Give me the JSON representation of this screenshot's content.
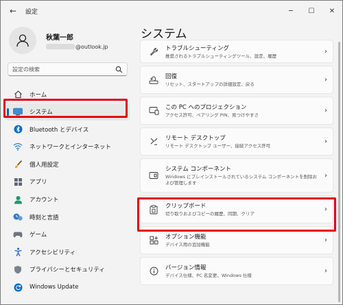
{
  "window": {
    "title": "設定",
    "back_glyph": "←",
    "minimize_glyph": "─",
    "maximize_glyph": "☐",
    "close_glyph": "✕"
  },
  "profile": {
    "name": "秋葉一郎",
    "email": "@outlook.jp"
  },
  "search": {
    "placeholder": "設定の検索"
  },
  "nav": {
    "items": [
      {
        "label": "ホーム",
        "icon": "home-icon"
      },
      {
        "label": "システム",
        "icon": "system-icon",
        "active": true
      },
      {
        "label": "Bluetooth とデバイス",
        "icon": "bluetooth-icon"
      },
      {
        "label": "ネットワークとインターネット",
        "icon": "network-icon"
      },
      {
        "label": "個人用設定",
        "icon": "brush-icon"
      },
      {
        "label": "アプリ",
        "icon": "apps-icon"
      },
      {
        "label": "アカウント",
        "icon": "account-icon"
      },
      {
        "label": "時刻と言語",
        "icon": "time-language-icon"
      },
      {
        "label": "ゲーム",
        "icon": "gaming-icon"
      },
      {
        "label": "アクセシビリティ",
        "icon": "accessibility-icon"
      },
      {
        "label": "プライバシーとセキュリティ",
        "icon": "shield-icon"
      },
      {
        "label": "Windows Update",
        "icon": "update-icon"
      }
    ]
  },
  "main": {
    "title": "システム",
    "cards": [
      {
        "title": "トラブルシューティング",
        "desc": "推奨されるトラブルシューティングツール、設定、履歴",
        "icon": "wrench-icon"
      },
      {
        "title": "回復",
        "desc": "リセット、スタートアップの詳細設定、戻る",
        "icon": "recovery-icon"
      },
      {
        "title": "この PC へのプロジェクション",
        "desc": "アクセス許可、ペアリング PIN、見つけやすさ",
        "icon": "projection-icon"
      },
      {
        "title": "リモート デスクトップ",
        "desc": "リモート デスクトップ ユーザー、接続アクセス許可",
        "icon": "remote-desktop-icon"
      },
      {
        "title": "システム コンポーネント",
        "desc": "Windows にプレインストールされているシステム コンポーネントを削除および管理します",
        "icon": "components-icon"
      },
      {
        "title": "クリップボード",
        "desc": "切り取りおよびコピーの履歴、同期、クリア",
        "icon": "clipboard-icon"
      },
      {
        "title": "オプション機能",
        "desc": "デバイス用の追加機能",
        "icon": "optional-features-icon"
      },
      {
        "title": "バージョン情報",
        "desc": "デバイス仕様、PC 名変更、Windows 仕様",
        "icon": "info-icon"
      }
    ]
  },
  "colors": {
    "accent": "#0067c0",
    "highlight": "#e60012"
  }
}
